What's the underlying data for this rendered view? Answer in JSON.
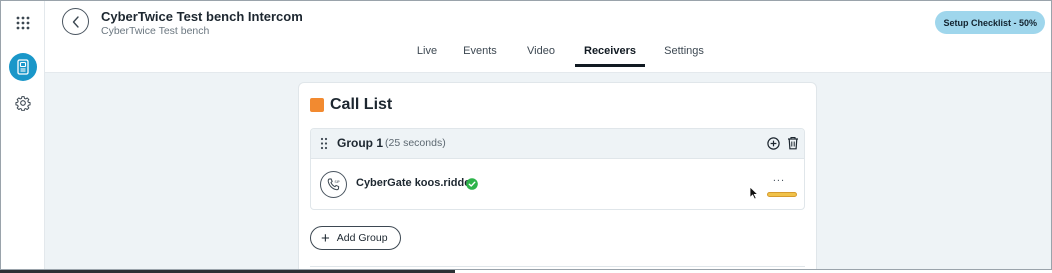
{
  "header": {
    "title": "CyberTwice Test bench Intercom",
    "subtitle": "CyberTwice Test bench",
    "checklist_label": "Setup Checklist - 50%"
  },
  "tabs": [
    {
      "label": "Live",
      "active": false
    },
    {
      "label": "Events",
      "active": false
    },
    {
      "label": "Video",
      "active": false
    },
    {
      "label": "Receivers",
      "active": true
    },
    {
      "label": "Settings",
      "active": false
    }
  ],
  "call_list": {
    "title": "Call List",
    "groups": [
      {
        "name": "Group 1",
        "duration": "(25 seconds)",
        "receivers": [
          {
            "name": "CyberGate koos.ridder",
            "verified": true,
            "more_label": "..."
          }
        ]
      }
    ],
    "add_group_label": "Add Group"
  },
  "colors": {
    "accent": "#1a97c9",
    "checklist_bg": "#9fd6ec",
    "call_list_marker": "#f28a30",
    "verified": "#2db34a",
    "highlight_bar": "#f0c24a"
  },
  "icons": {
    "rail": [
      "apps-grid-icon",
      "intercom-icon",
      "settings-gear-icon"
    ],
    "back": "chevron-left-icon",
    "group_actions": [
      "add-circle-icon",
      "trash-icon"
    ],
    "receiver": "phone-sip-icon",
    "status": "verified-check-icon"
  }
}
